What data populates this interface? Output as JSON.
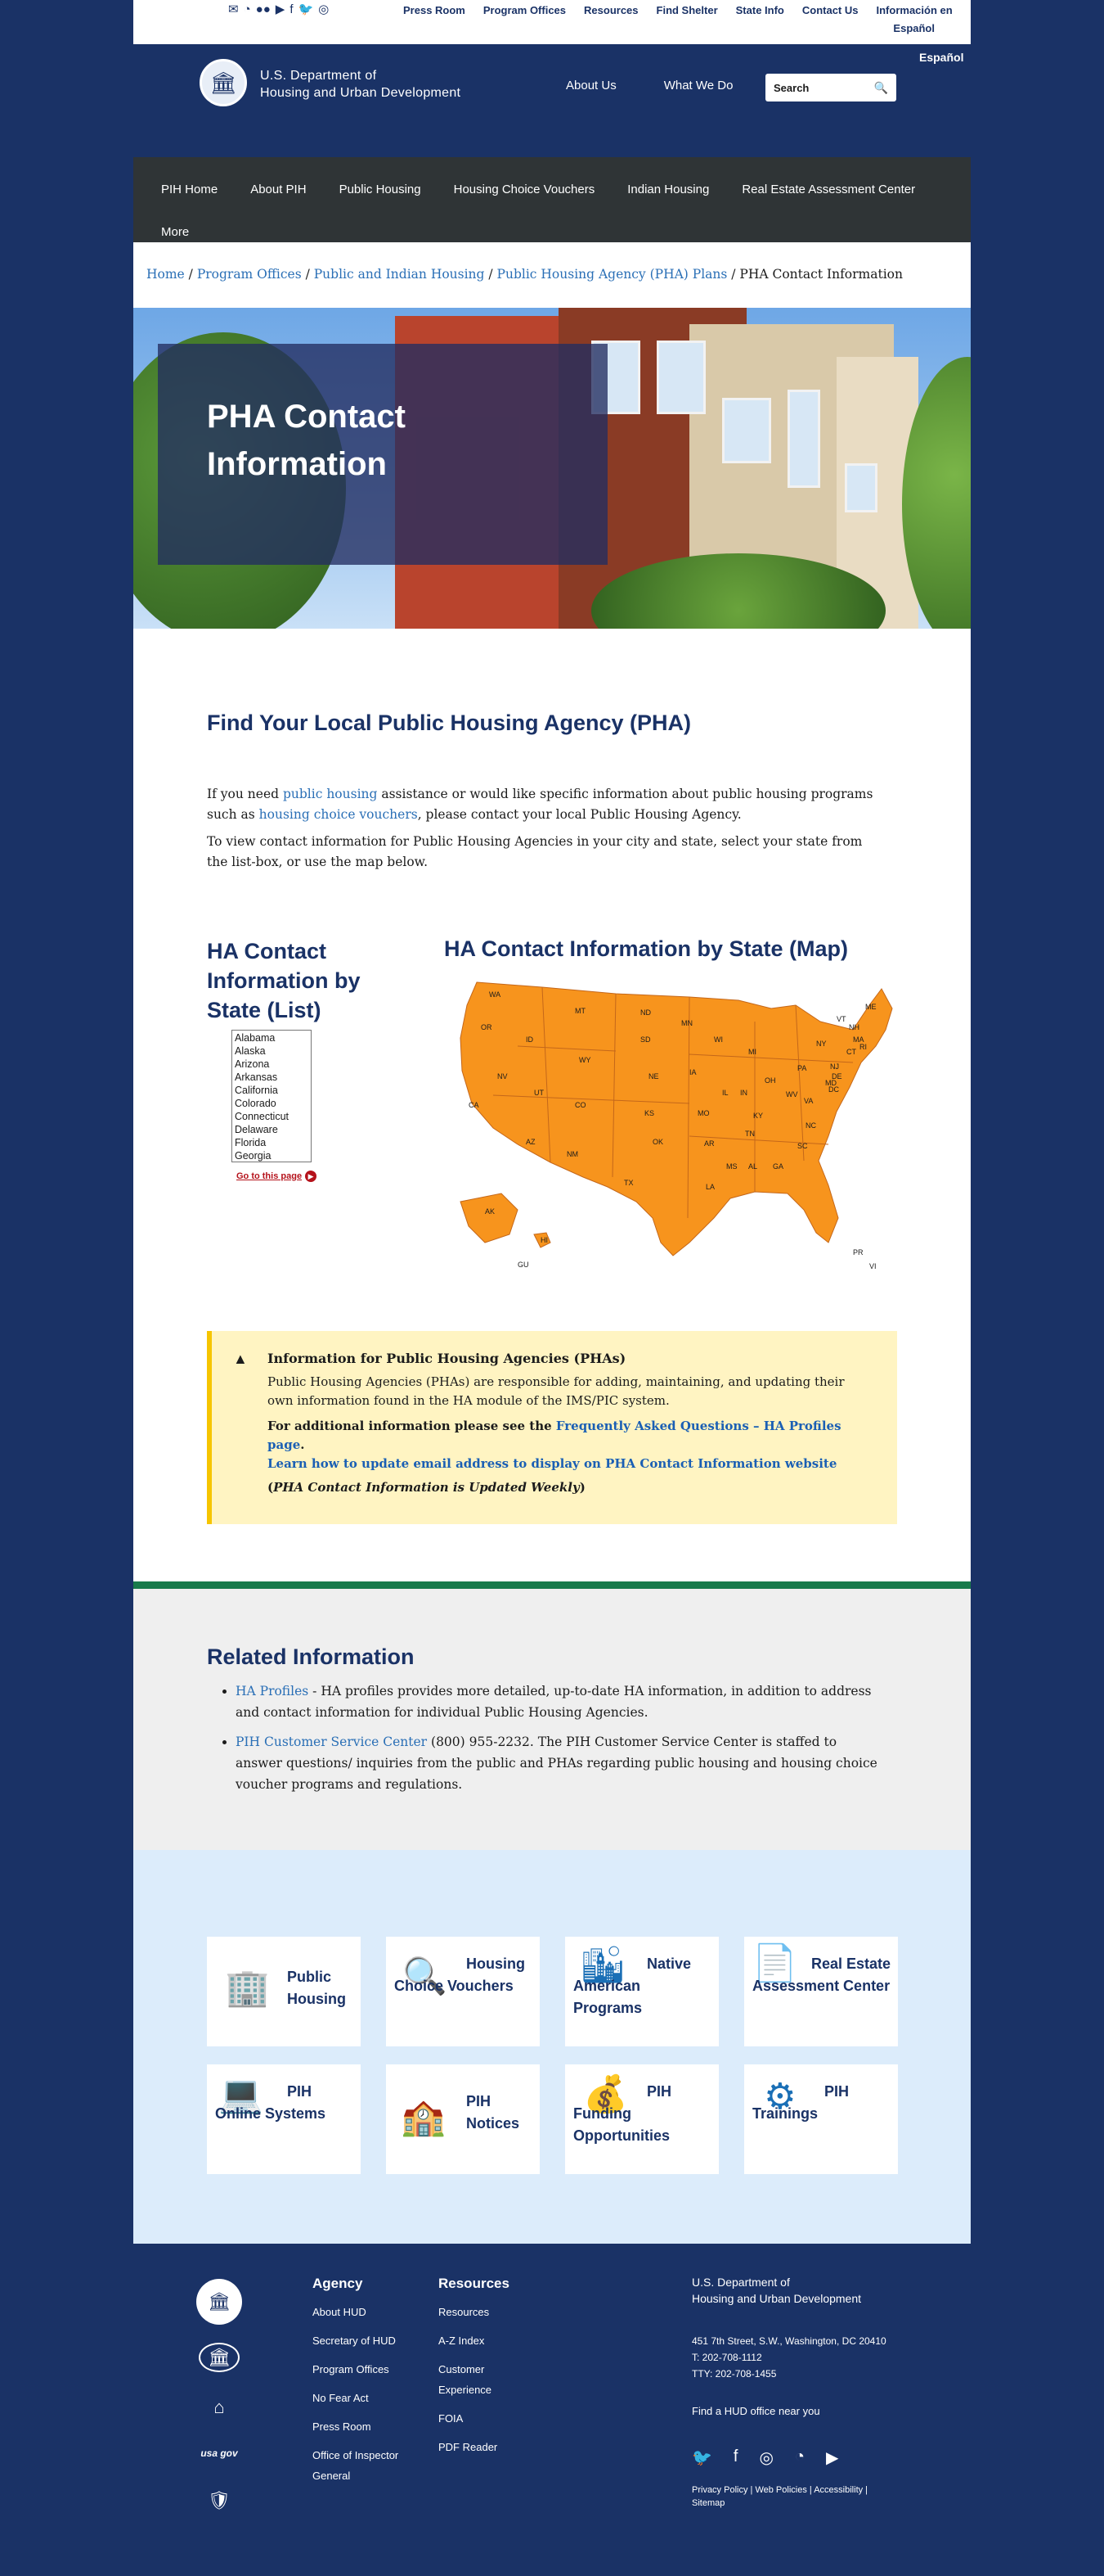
{
  "utility": {
    "links": [
      "Press Room",
      "Program Offices",
      "Resources",
      "Find Shelter",
      "State Info",
      "Contact Us",
      "Información en"
    ],
    "espanol_inline": "Español",
    "espanol": "Español"
  },
  "header": {
    "agency_line1": "U.S. Department of",
    "agency_line2": "Housing and Urban Development",
    "nav": [
      "About Us",
      "What We Do"
    ],
    "search_placeholder": "Search"
  },
  "section_nav": [
    "PIH Home",
    "About PIH",
    "Public Housing",
    "Housing Choice Vouchers",
    "Indian Housing",
    "Real Estate Assessment Center",
    "More"
  ],
  "breadcrumb": {
    "items": [
      "Home",
      "Program Offices",
      "Public and Indian Housing",
      "Public Housing Agency (PHA) Plans"
    ],
    "current": "PHA Contact Information",
    "separator": " / "
  },
  "hero": {
    "title": "PHA Contact Information"
  },
  "find": {
    "title": "Find Your Local Public Housing Agency (PHA)",
    "p1_a": "If you need ",
    "p1_link1": "public housing",
    "p1_b": " assistance or would like specific information about public housing programs such as ",
    "p1_link2": "housing choice vouchers",
    "p1_c": ", please contact your local Public Housing Agency.",
    "p2": "To view contact information for Public Housing Agencies in your city and state, select your state from the list-box, or use the map below."
  },
  "list": {
    "title": "HA Contact Information by State (List)",
    "states": [
      "Alabama",
      "Alaska",
      "Arizona",
      "Arkansas",
      "California",
      "Colorado",
      "Connecticut",
      "Delaware",
      "Florida",
      "Georgia"
    ],
    "goto": "Go to this page"
  },
  "map": {
    "title": "HA Contact Information by State (Map)",
    "labels": [
      "WA",
      "OR",
      "ID",
      "MT",
      "WY",
      "ND",
      "SD",
      "NE",
      "MN",
      "WI",
      "MI",
      "IA",
      "IL",
      "IN",
      "OH",
      "PA",
      "NY",
      "VT",
      "NH",
      "ME",
      "MA",
      "RI",
      "CT",
      "NJ",
      "DE",
      "MD",
      "DC",
      "VA",
      "WV",
      "KY",
      "TN",
      "NC",
      "SC",
      "GA",
      "AL",
      "MS",
      "LA",
      "AR",
      "MO",
      "KS",
      "OK",
      "TX",
      "NM",
      "CO",
      "UT",
      "AZ",
      "NV",
      "CA",
      "AK",
      "HI",
      "GU",
      "VI",
      "PR"
    ],
    "fill_color": "#f7941d"
  },
  "notice": {
    "title": "Information for Public Housing Agencies (PHAs)",
    "body": "Public Housing Agencies (PHAs) are responsible for adding, maintaining, and updating their own information found in the HA module of the IMS/PIC system.",
    "more_a": "For additional information please see the ",
    "more_link": "Frequently Asked Questions – HA Profiles page",
    "more_b": ".",
    "email_link": "Learn how to update email address to display on PHA Contact Information website",
    "updated": "PHA Contact Information is Updated Weekly"
  },
  "related": {
    "title": "Related Information",
    "item1_link": "HA Profiles",
    "item1_text": " - HA profiles provides more detailed, up-to-date HA information, in addition to address and contact information for individual Public Housing Agencies.",
    "item2_link": "PIH Customer Service Center",
    "item2_text": " (800) 955-2232. The PIH Customer Service Center is staffed to answer questions/ inquiries from the public and PHAs regarding public housing and housing choice voucher programs and regulations."
  },
  "cards": [
    {
      "label": "Public Housing",
      "icon": "building-icon"
    },
    {
      "label": "Housing Choice Vouchers",
      "icon": "magnifier-icon"
    },
    {
      "label": "Native American Programs",
      "icon": "city-icon"
    },
    {
      "label": "Real Estate Assessment Center",
      "icon": "document-icon"
    },
    {
      "label": "PIH Online Systems",
      "icon": "laptop-icon"
    },
    {
      "label": "PIH Notices",
      "icon": "house-notice-icon"
    },
    {
      "label": "PIH Funding Opportunities",
      "icon": "money-bag-icon"
    },
    {
      "label": "PIH Trainings",
      "icon": "gear-icon"
    }
  ],
  "footer": {
    "agency_head": "Agency",
    "agency_links": [
      "About HUD",
      "Secretary of HUD",
      "Program Offices",
      "No Fear Act",
      "Press Room",
      "Office of Inspector General"
    ],
    "resources_head": "Resources",
    "resources_links": [
      "Resources",
      "A-Z Index",
      "Customer Experience",
      "FOIA",
      "PDF Reader"
    ],
    "org_line1": "U.S. Department of",
    "org_line2": "Housing and Urban Development",
    "address": "451 7th Street, S.W., Washington, DC 20410",
    "phone": "T: 202-708-1112",
    "tty": "TTY: 202-708-1455",
    "find_office": "Find a HUD office near you",
    "usagov": "usa gov",
    "policy": [
      "Privacy Policy",
      "Web Policies",
      "Accessibility",
      "Sitemap"
    ]
  }
}
